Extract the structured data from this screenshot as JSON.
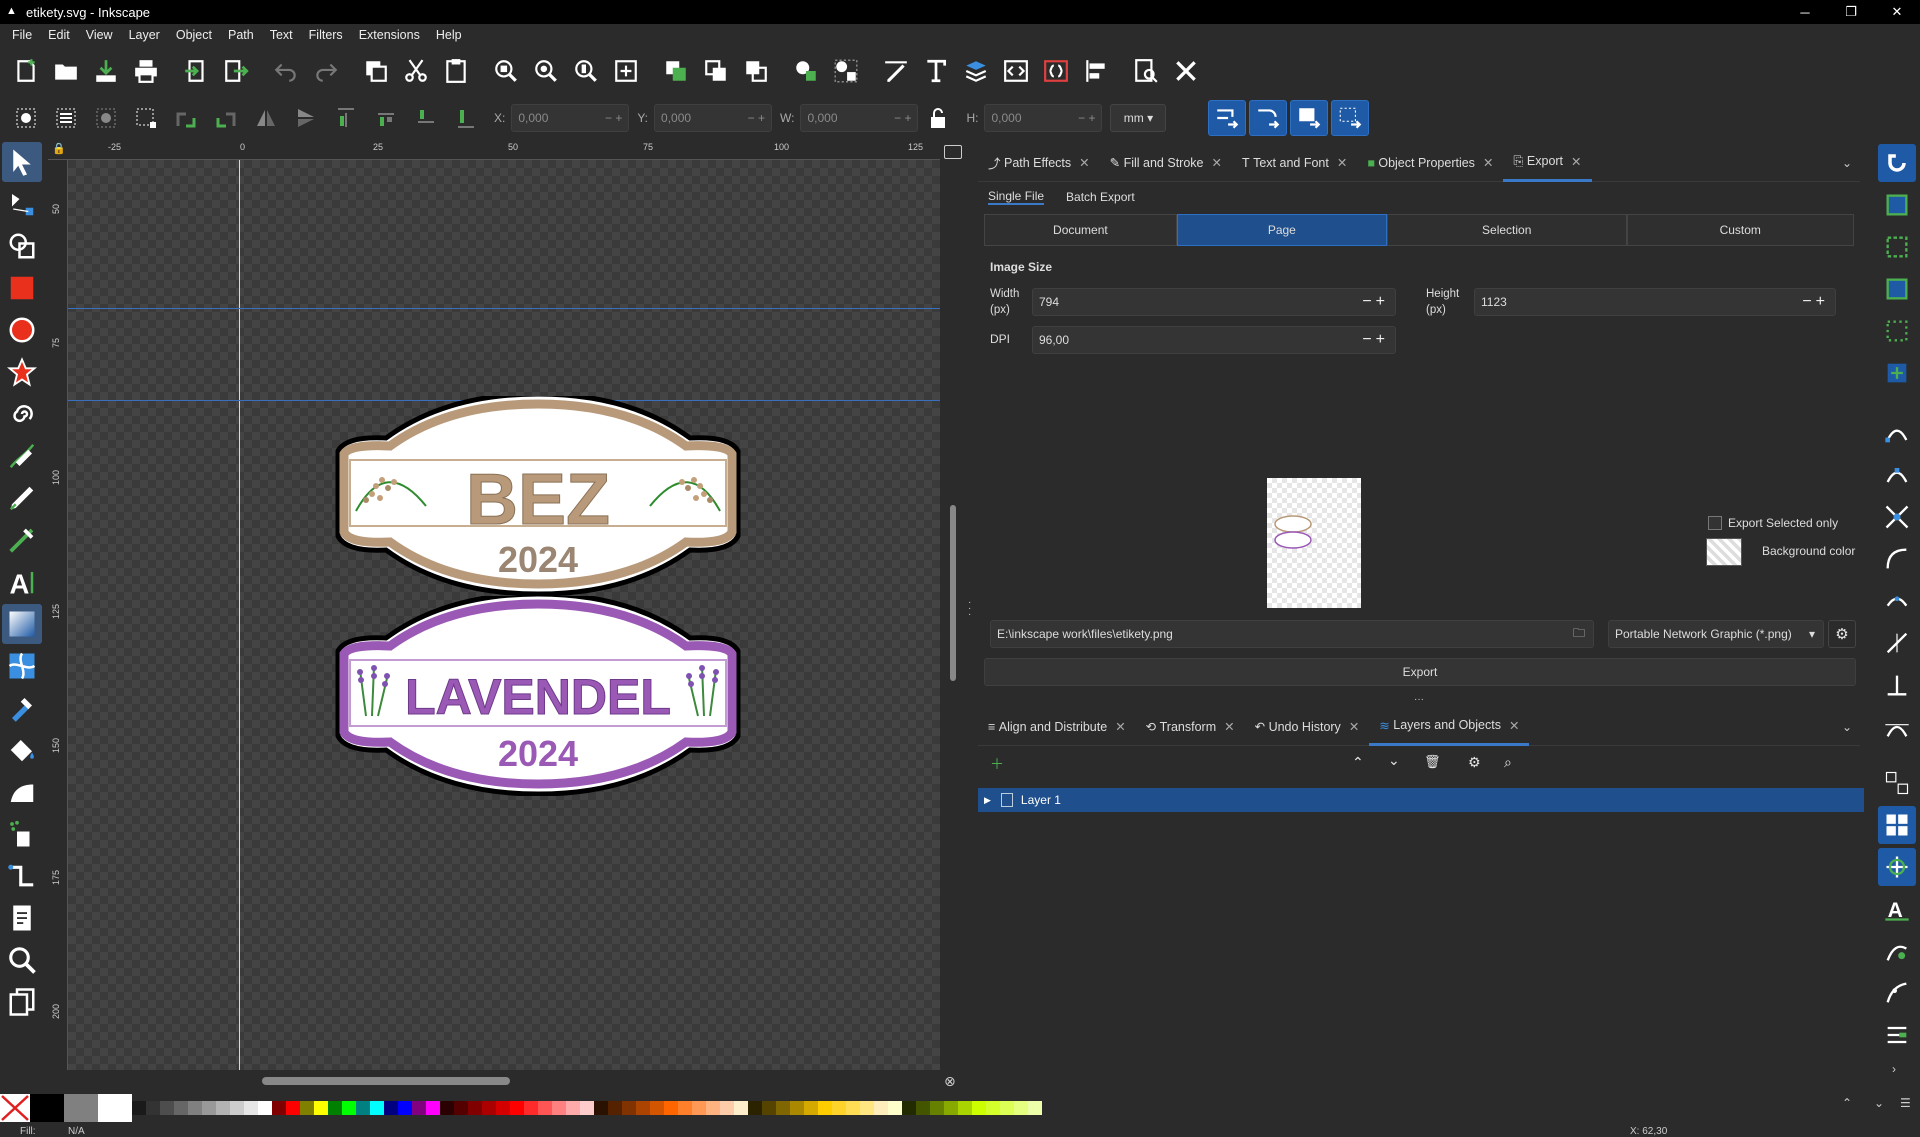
{
  "window": {
    "title": "etikety.svg - Inkscape"
  },
  "menu": [
    "File",
    "Edit",
    "View",
    "Layer",
    "Object",
    "Path",
    "Text",
    "Filters",
    "Extensions",
    "Help"
  ],
  "toolbar2": {
    "x_label": "X:",
    "x_value": "0,000",
    "y_label": "Y:",
    "y_value": "0,000",
    "w_label": "W:",
    "w_value": "0,000",
    "h_label": "H:",
    "h_value": "0,000",
    "unit": "mm"
  },
  "ruler": {
    "h_ticks": [
      "-25",
      "0",
      "25",
      "50",
      "75",
      "100",
      "125"
    ],
    "v_ticks": [
      "50",
      "75",
      "100",
      "125",
      "150",
      "175",
      "200"
    ]
  },
  "canvas": {
    "label1": {
      "line1": "BEZ",
      "line2": "2024"
    },
    "label2": {
      "line1": "LAVENDEL",
      "line2": "2024"
    }
  },
  "dock_tabs": [
    {
      "label": "Path Effects",
      "icon": "path-effects-icon"
    },
    {
      "label": "Fill and Stroke",
      "icon": "fill-stroke-icon"
    },
    {
      "label": "Text and Font",
      "icon": "text-font-icon"
    },
    {
      "label": "Object Properties",
      "icon": "object-properties-icon"
    },
    {
      "label": "Export",
      "icon": "export-icon",
      "active": true
    }
  ],
  "export": {
    "subtabs": [
      "Single File",
      "Batch Export"
    ],
    "areas": [
      "Document",
      "Page",
      "Selection",
      "Custom"
    ],
    "active_area": "Page",
    "image_size_heading": "Image Size",
    "width_label": "Width\n(px)",
    "width_value": "794",
    "height_label": "Height\n(px)",
    "height_value": "1123",
    "dpi_label": "DPI",
    "dpi_value": "96,00",
    "export_selected_only": "Export Selected only",
    "background_color": "Background color",
    "filename": "E:\\inkscape work\\files\\etikety.png",
    "format": "Portable Network Graphic (*.png)",
    "export_button": "Export"
  },
  "dock2_tabs": [
    {
      "label": "Align and Distribute"
    },
    {
      "label": "Transform"
    },
    {
      "label": "Undo History"
    },
    {
      "label": "Layers and Objects",
      "active": true
    }
  ],
  "layers": [
    {
      "name": "Layer 1"
    }
  ],
  "status": {
    "fill_label": "Fill:",
    "fill_value": "N/A",
    "coords": "X:  62,30"
  },
  "colors": {
    "accent": "#1f4f8c",
    "bez_brown": "#b89a7a",
    "lavender": "#9b59b6"
  }
}
